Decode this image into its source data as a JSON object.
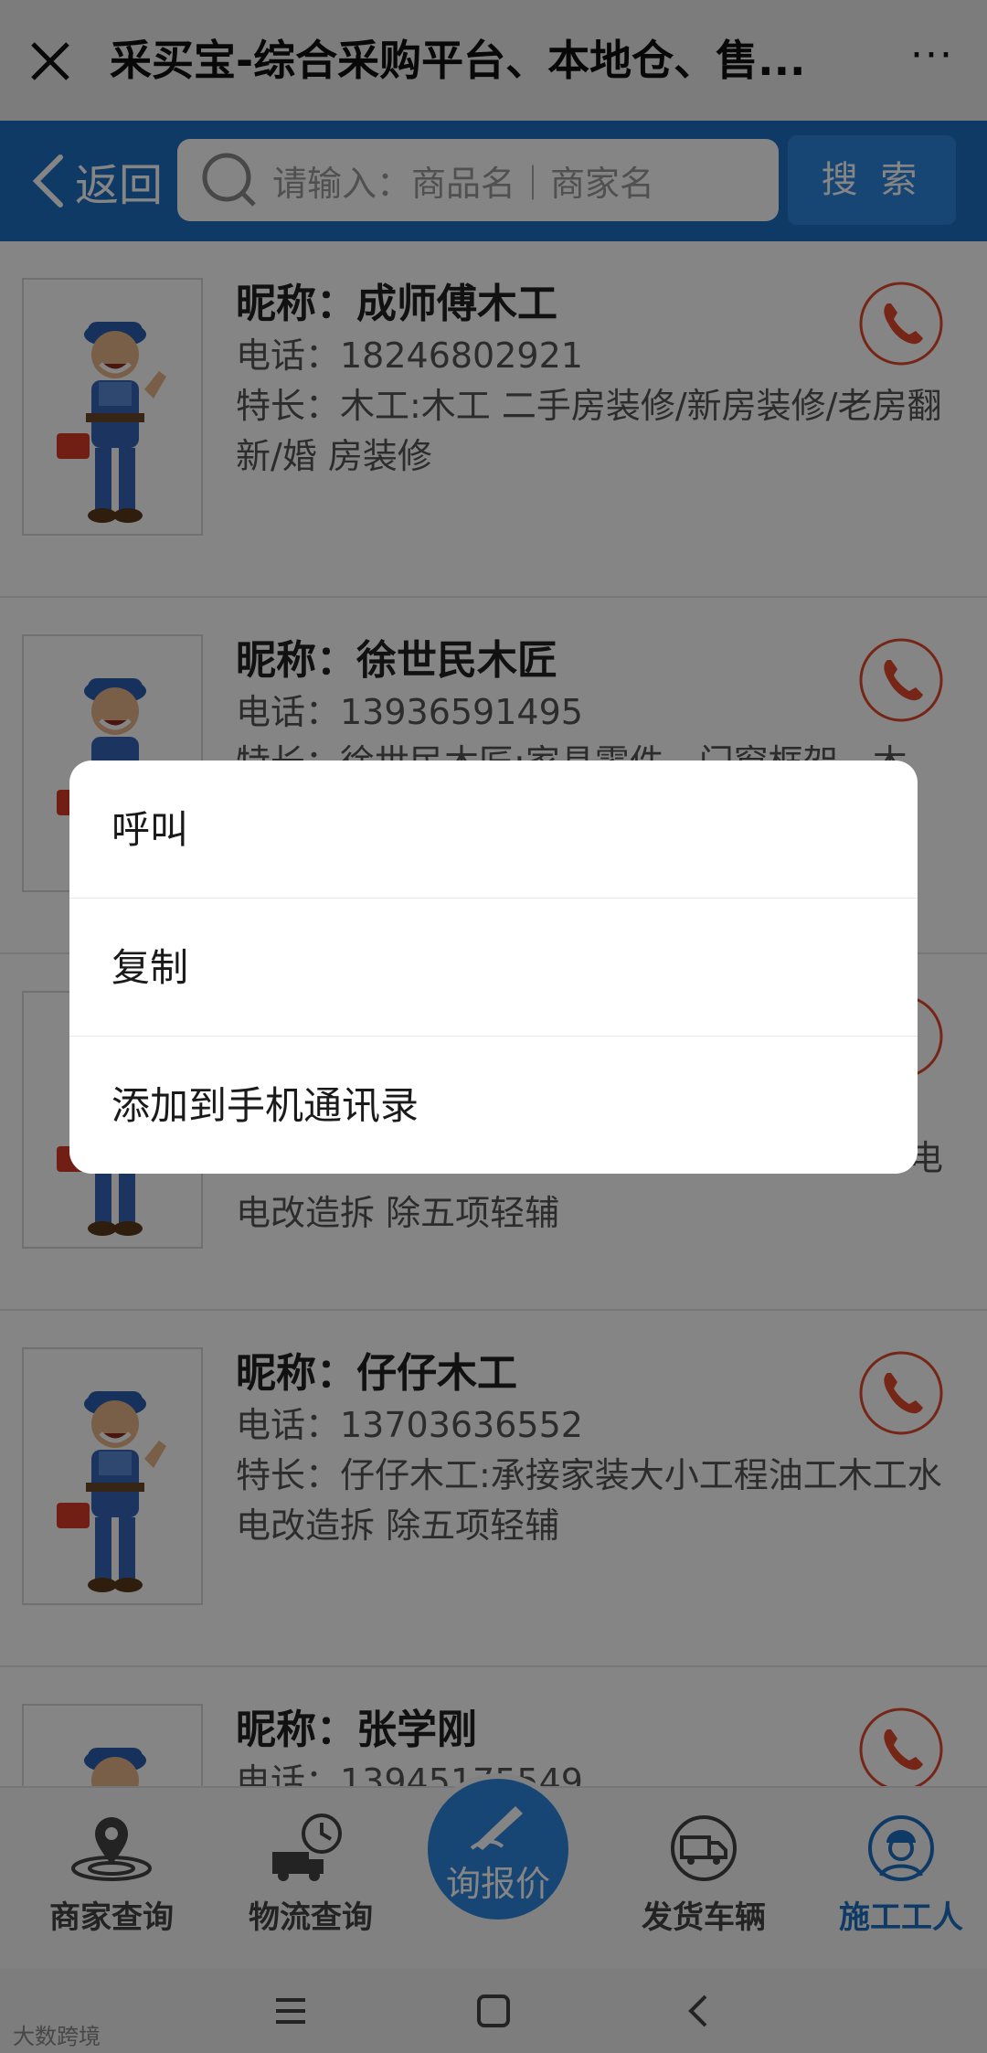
{
  "titlebar": {
    "title": "采买宝-综合采购平台、本地仓、售...",
    "more": "···"
  },
  "header": {
    "back_label": "返回",
    "search_placeholder": "请输入：商品名｜商家名",
    "search_button": "搜 索"
  },
  "workers": [
    {
      "nick": "昵称：成师傅木工",
      "phone": "电话：18246802921",
      "specialty": "特长：木工:木工 二手房装修/新房装修/老房翻新/婚 房装修"
    },
    {
      "nick": "昵称：徐世民木匠",
      "phone": "电话：13936591495",
      "specialty": "特长：徐世民木匠:家具零件、门窗框架、木"
    },
    {
      "nick": "",
      "phone": "",
      "specialty": "电改造拆 除五项轻辅"
    },
    {
      "nick": "昵称：仔仔木工",
      "phone": "电话：13703636552",
      "specialty": "特长：仔仔木工:承接家装大小工程油工木工水电改造拆 除五项轻辅"
    },
    {
      "nick": "昵称：张学刚",
      "phone": "电话：13945175549",
      "specialty": ""
    }
  ],
  "item3_right_fragment": "电",
  "bottom_nav": {
    "merchant": "商家查询",
    "logistics": "物流查询",
    "quote": "询报价",
    "vehicle": "发货车辆",
    "worker": "施工工人"
  },
  "dialog": {
    "call": "呼叫",
    "copy": "复制",
    "add_contact": "添加到手机通讯录"
  },
  "watermark": "大数跨境",
  "colors": {
    "header_blue": "#1f6fc4",
    "button_blue": "#2e86de",
    "phone_red": "#e0492c"
  }
}
